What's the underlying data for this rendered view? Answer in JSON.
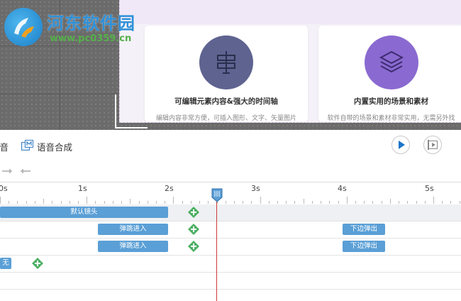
{
  "watermark": {
    "title": "河东软件园",
    "url": "www.pc0359.cn"
  },
  "cards": [
    {
      "icon": "signpost-icon",
      "title": "可编辑元素内容&强大的时间轴",
      "desc": "编辑内容非常方便，可插入图形、文字、矢量图片",
      "circle_color": "#5e6390"
    },
    {
      "icon": "layers-icon",
      "title": "内置实用的场景和素材",
      "desc": "软件自带的场景和素材非常实用，无需另外找",
      "circle_color": "#8a6ad0"
    }
  ],
  "toolbar": {
    "audio_label": "声音",
    "tts_label": "语音合成"
  },
  "timeline": {
    "ruler_labels": [
      "0s",
      "1s",
      "2s",
      "3s",
      "4s",
      "5s"
    ],
    "tracks": [
      {
        "bars": [
          {
            "label": "默认镜头"
          }
        ]
      },
      {
        "bars": [
          {
            "label": "弹跳进入"
          },
          {
            "label": "下边弹出"
          }
        ]
      },
      {
        "bars": [
          {
            "label": "弹跳进入"
          },
          {
            "label": "下边弹出"
          }
        ]
      },
      {
        "bars": [
          {
            "label": "无"
          }
        ]
      }
    ],
    "playhead_time_s": 2.55,
    "accent_color": "#5a9fd6",
    "playhead_color": "#cf3a3a"
  }
}
